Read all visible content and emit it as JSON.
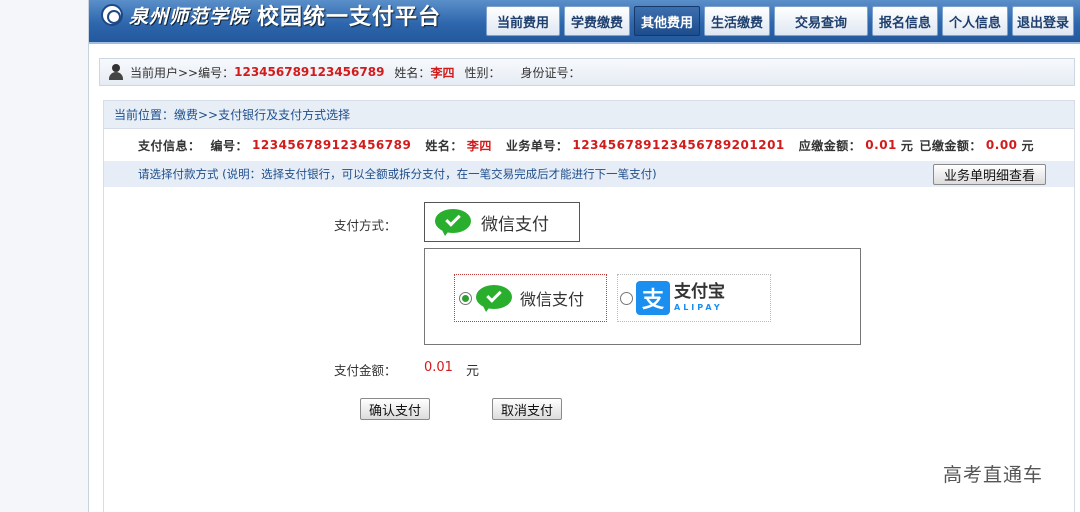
{
  "header": {
    "school_name": "泉州师范学院",
    "platform_title": "校园统一支付平台",
    "nav": [
      {
        "label": "当前费用",
        "active": false
      },
      {
        "label": "学费缴费",
        "active": false
      },
      {
        "label": "其他费用",
        "active": true
      },
      {
        "label": "生活缴费",
        "active": false
      },
      {
        "label": "交易查询",
        "active": false
      },
      {
        "label": "报名信息",
        "active": false
      },
      {
        "label": "个人信息",
        "active": false
      },
      {
        "label": "退出登录",
        "active": false
      }
    ]
  },
  "userbar": {
    "current_user_label": "当前用户>>编号：",
    "id_value": "123456789123456789",
    "name_label": "姓名：",
    "name_value": "李四",
    "gender_label": "性别：",
    "idcard_label": "身份证号："
  },
  "panel": {
    "breadcrumb": "当前位置：缴费>>支付银行及支付方式选择",
    "payinfo": {
      "prefix": "支付信息：",
      "id_label": "编号：",
      "id_value": "123456789123456789",
      "name_label": "姓名：",
      "name_value": "李四",
      "order_label": "业务单号：",
      "order_value": "123456789123456789201201",
      "due_label": "应缴金额：",
      "due_value": "0.01",
      "due_unit": "元",
      "paid_label": "已缴金额：",
      "paid_value": "0.00",
      "paid_unit": "元"
    },
    "note": "请选择付款方式 (说明：选择支付银行，可以全额或拆分支付，在一笔交易完成后才能进行下一笔支付)",
    "detail_button": "业务单明细查看",
    "method_label": "支付方式：",
    "selected_method": "微信支付",
    "options": {
      "wechat": "微信支付",
      "alipay_cn": "支付宝",
      "alipay_en": "ALIPAY",
      "alipay_glyph": "支",
      "selected": "wechat"
    },
    "amount_label": "支付金额：",
    "amount_value": "0.01",
    "amount_unit": "元",
    "confirm_button": "确认支付",
    "cancel_button": "取消支付"
  },
  "watermark": "高考直通车",
  "colors": {
    "header_blue": "#2e67ad",
    "active_nav": "#1d4c8c",
    "highlight_red": "#d21b1b",
    "wechat_green": "#2aae2d",
    "alipay_blue": "#1b8ff0"
  }
}
